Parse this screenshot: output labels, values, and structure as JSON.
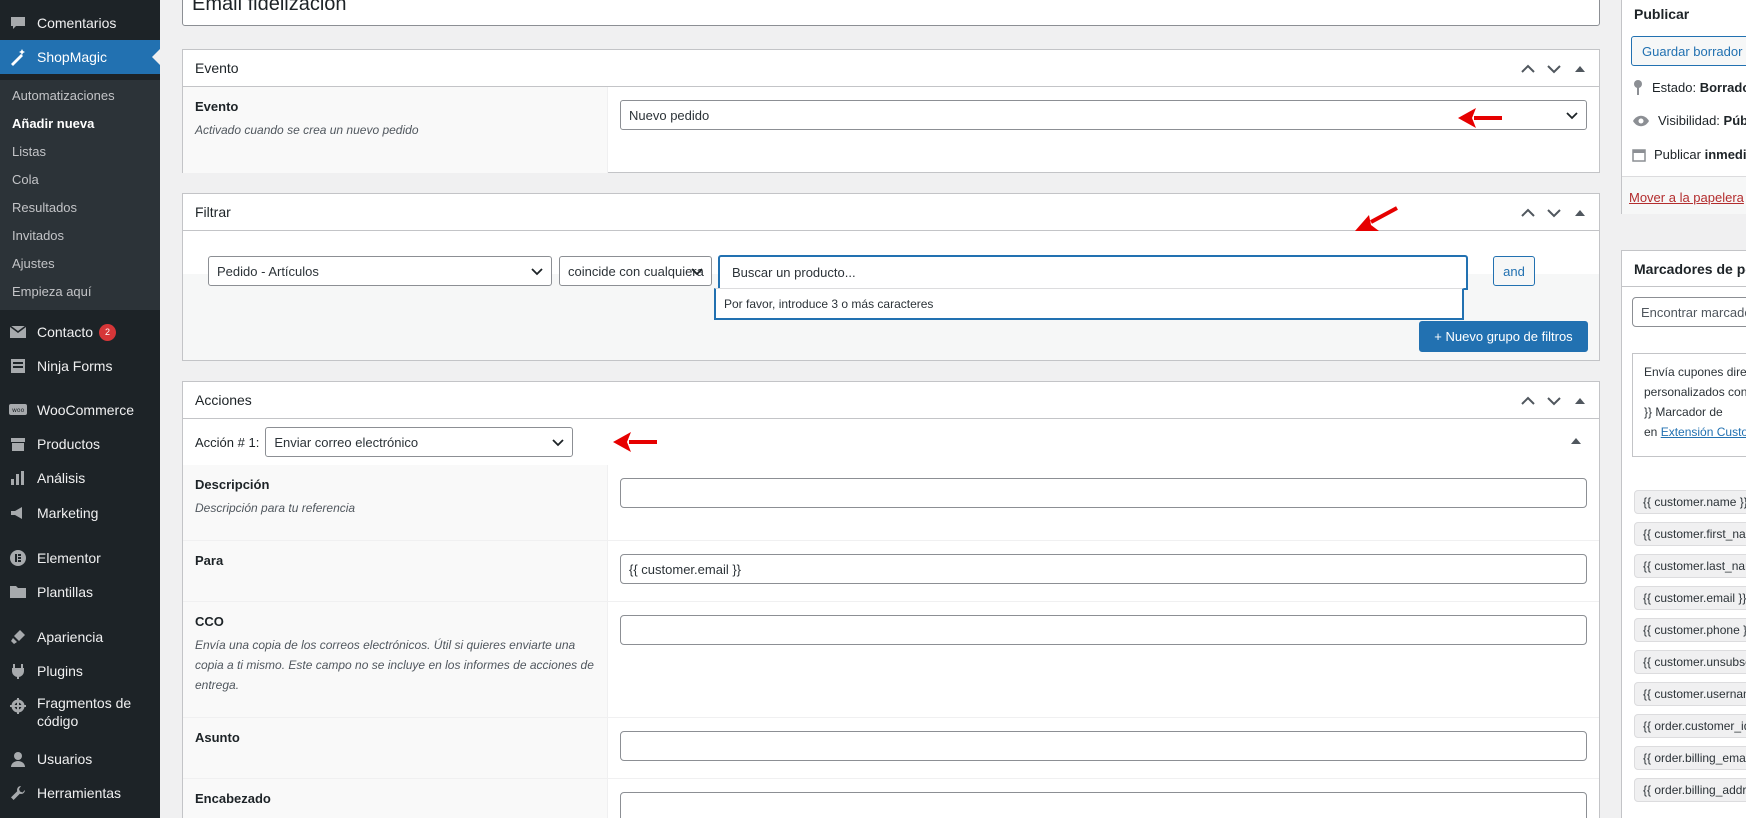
{
  "sidebar": {
    "items": [
      {
        "label": "Comentarios",
        "icon": "comment-icon"
      },
      {
        "label": "ShopMagic",
        "icon": "magic-wand-icon"
      },
      {
        "label": "Contacto",
        "icon": "mail-icon",
        "badge": "2"
      },
      {
        "label": "Ninja Forms",
        "icon": "forms-icon"
      },
      {
        "label": "WooCommerce",
        "icon": "woo-icon"
      },
      {
        "label": "Productos",
        "icon": "archive-icon"
      },
      {
        "label": "Análisis",
        "icon": "chart-bar-icon"
      },
      {
        "label": "Marketing",
        "icon": "megaphone-icon"
      },
      {
        "label": "Elementor",
        "icon": "elementor-icon"
      },
      {
        "label": "Plantillas",
        "icon": "folder-icon"
      },
      {
        "label": "Apariencia",
        "icon": "brush-icon"
      },
      {
        "label": "Plugins",
        "icon": "plugin-icon"
      },
      {
        "label": "Fragmentos de código",
        "icon": "code-icon"
      },
      {
        "label": "Usuarios",
        "icon": "user-icon"
      },
      {
        "label": "Herramientas",
        "icon": "wrench-icon"
      }
    ],
    "submenu": [
      "Automatizaciones",
      "Añadir nueva",
      "Listas",
      "Cola",
      "Resultados",
      "Invitados",
      "Ajustes",
      "Empieza aquí"
    ]
  },
  "title": "Email fidelizacion",
  "evento": {
    "heading": "Evento",
    "label": "Evento",
    "description": "Activado cuando se crea un nuevo pedido",
    "value": "Nuevo pedido"
  },
  "filtrar": {
    "heading": "Filtrar",
    "field": "Pedido - Artículos",
    "condition": "coincide con cualquiera",
    "search_placeholder": "Buscar un producto...",
    "search_hint": "Por favor, introduce 3 o más caracteres",
    "and_label": "and",
    "new_group_label": "+ Nuevo grupo de filtros"
  },
  "acciones": {
    "heading": "Acciones",
    "action_label": "Acción # 1:",
    "action_value": "Enviar correo electrónico",
    "fields": [
      {
        "label": "Descripción",
        "description": "Descripción para tu referencia",
        "value": ""
      },
      {
        "label": "Para",
        "description": "",
        "value": "{{ customer.email }}"
      },
      {
        "label": "CCO",
        "description": "Envía una copia de los correos electrónicos. Útil si quieres enviarte una copia a ti mismo. Este campo no se incluye en los informes de acciones de entrega.",
        "value": ""
      },
      {
        "label": "Asunto",
        "description": "",
        "value": ""
      },
      {
        "label": "Encabezado",
        "description": "",
        "value": ""
      }
    ]
  },
  "publicar": {
    "heading": "Publicar",
    "save_draft": "Guardar borrador",
    "estado_label": "Estado:",
    "estado_value": "Borrador",
    "visibilidad_label": "Visibilidad:",
    "visibilidad_value": "Pública",
    "publicar_label": "Publicar",
    "publicar_value": "inmediatamente",
    "trash": "Mover a la papelera"
  },
  "marcadores": {
    "heading": "Marcadores de posición",
    "search_placeholder": "Encontrar marcador",
    "info_line1": "Envía cupones directos",
    "info_line2": "personalizados con",
    "info_line3": "}} Marcador de",
    "info_line4_prefix": "en",
    "info_link": "Extensión Customer",
    "tags": [
      "{{ customer.name }}",
      "{{ customer.first_name }}",
      "{{ customer.last_name }}",
      "{{ customer.email }}",
      "{{ customer.phone }}",
      "{{ customer.unsubscribe_url }}",
      "{{ customer.username }}",
      "{{ order.customer_id }}",
      "{{ order.billing_email }}",
      "{{ order.billing_address }}"
    ]
  },
  "colors": {
    "accent": "#2271b1",
    "sidebar": "#1d2327",
    "arrow": "#e60000"
  }
}
